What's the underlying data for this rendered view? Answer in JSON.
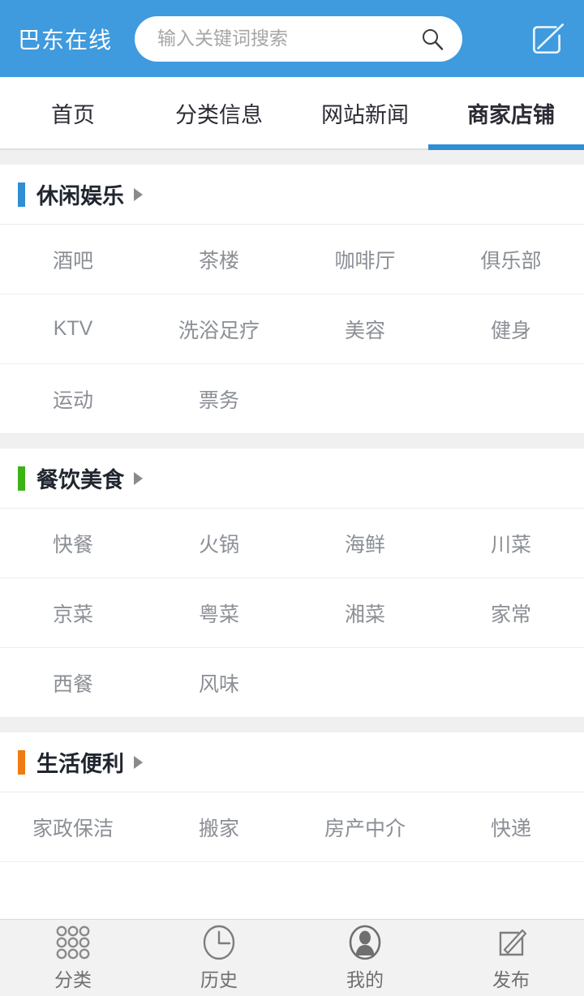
{
  "header": {
    "brand": "巴东在线",
    "brand_color": "#ffffff",
    "background": "#3f9ade",
    "search": {
      "placeholder": "输入关键词搜索",
      "value": "",
      "icon": "search-icon"
    },
    "compose_icon": "compose-icon"
  },
  "tabs": {
    "active_index": 3,
    "accent": "#2f8ed4",
    "items": [
      {
        "label": "首页"
      },
      {
        "label": "分类信息"
      },
      {
        "label": "网站新闻"
      },
      {
        "label": "商家店铺"
      }
    ]
  },
  "sections": [
    {
      "title": "休闲娱乐",
      "accent": "#2f8ed4",
      "arrow": "chevron-right-icon",
      "rows": [
        [
          "酒吧",
          "茶楼",
          "咖啡厅",
          "俱乐部"
        ],
        [
          "KTV",
          "洗浴足疗",
          "美容",
          "健身"
        ],
        [
          "运动",
          "票务",
          "",
          ""
        ]
      ]
    },
    {
      "title": "餐饮美食",
      "accent": "#3cb315",
      "arrow": "chevron-right-icon",
      "rows": [
        [
          "快餐",
          "火锅",
          "海鲜",
          "川菜"
        ],
        [
          "京菜",
          "粤菜",
          "湘菜",
          "家常"
        ],
        [
          "西餐",
          "风味",
          "",
          ""
        ]
      ]
    },
    {
      "title": "生活便利",
      "accent": "#f07b11",
      "arrow": "chevron-right-icon",
      "rows": [
        [
          "家政保洁",
          "搬家",
          "房产中介",
          "快递"
        ]
      ]
    }
  ],
  "bottom_nav": {
    "background": "#f2f2f2",
    "items": [
      {
        "label": "分类",
        "icon": "grid-dots-icon"
      },
      {
        "label": "历史",
        "icon": "clock-icon"
      },
      {
        "label": "我的",
        "icon": "user-circle-icon"
      },
      {
        "label": "发布",
        "icon": "compose-square-icon"
      }
    ]
  }
}
